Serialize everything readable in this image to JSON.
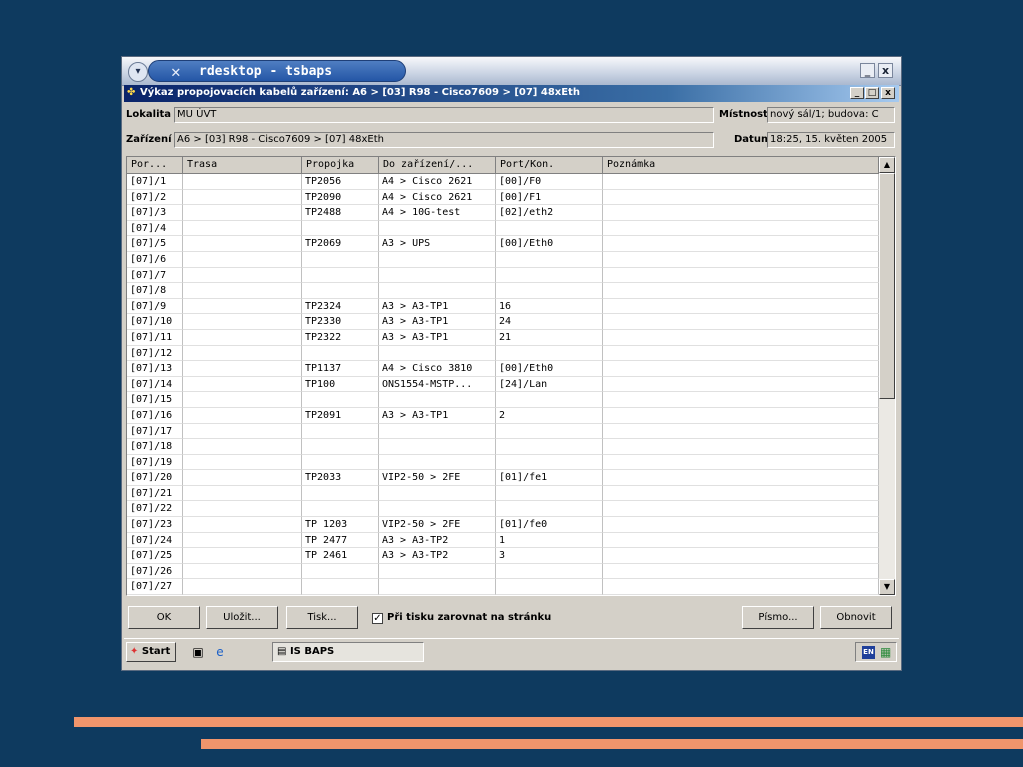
{
  "rdesktop": {
    "title": "rdesktop - tsbaps",
    "buttons": {
      "minimize": "_",
      "close": "x"
    }
  },
  "app": {
    "title": "Výkaz propojovacích kabelů zařízení: A6 > [03] R98 - Cisco7609 > [07] 48xEth",
    "buttons": {
      "minimize": "_",
      "maximize": "□",
      "close": "x"
    }
  },
  "fields": {
    "lokalita": {
      "label": "Lokalita",
      "value": "MU ÚVT"
    },
    "zarizeni": {
      "label": "Zařízení",
      "value": "A6 > [03] R98 - Cisco7609 > [07] 48xEth"
    },
    "mistnost": {
      "label": "Místnost",
      "value": "nový sál/1; budova: C"
    },
    "datum": {
      "label": "Datum",
      "value": "18:25, 15. květen 2005"
    }
  },
  "table": {
    "headers": [
      "Por...",
      "Trasa",
      "Propojka",
      "Do zařízení/...",
      "Port/Kon.",
      "Poznámka"
    ],
    "rows": [
      [
        "[07]/1",
        "",
        "TP2056",
        "A4 > Cisco 2621",
        "[00]/F0",
        ""
      ],
      [
        "[07]/2",
        "",
        "TP2090",
        "A4 > Cisco 2621",
        "[00]/F1",
        ""
      ],
      [
        "[07]/3",
        "",
        "TP2488",
        "A4 > 10G-test",
        "[02]/eth2",
        ""
      ],
      [
        "[07]/4",
        "",
        "",
        "",
        "",
        ""
      ],
      [
        "[07]/5",
        "",
        "TP2069",
        "A3 > UPS",
        "[00]/Eth0",
        ""
      ],
      [
        "[07]/6",
        "",
        "",
        "",
        "",
        ""
      ],
      [
        "[07]/7",
        "",
        "",
        "",
        "",
        ""
      ],
      [
        "[07]/8",
        "",
        "",
        "",
        "",
        ""
      ],
      [
        "[07]/9",
        "",
        "TP2324",
        "A3 > A3-TP1",
        "16",
        ""
      ],
      [
        "[07]/10",
        "",
        "TP2330",
        "A3 > A3-TP1",
        "24",
        ""
      ],
      [
        "[07]/11",
        "",
        "TP2322",
        "A3 > A3-TP1",
        "21",
        ""
      ],
      [
        "[07]/12",
        "",
        "",
        "",
        "",
        ""
      ],
      [
        "[07]/13",
        "",
        "TP1137",
        "A4 > Cisco 3810",
        "[00]/Eth0",
        ""
      ],
      [
        "[07]/14",
        "",
        "TP100",
        "ONS1554-MSTP...",
        "[24]/Lan",
        ""
      ],
      [
        "[07]/15",
        "",
        "",
        "",
        "",
        ""
      ],
      [
        "[07]/16",
        "",
        "TP2091",
        "A3 > A3-TP1",
        "2",
        ""
      ],
      [
        "[07]/17",
        "",
        "",
        "",
        "",
        ""
      ],
      [
        "[07]/18",
        "",
        "",
        "",
        "",
        ""
      ],
      [
        "[07]/19",
        "",
        "",
        "",
        "",
        ""
      ],
      [
        "[07]/20",
        "",
        "TP2033",
        "VIP2-50 > 2FE",
        "[01]/fe1",
        ""
      ],
      [
        "[07]/21",
        "",
        "",
        "",
        "",
        ""
      ],
      [
        "[07]/22",
        "",
        "",
        "",
        "",
        ""
      ],
      [
        "[07]/23",
        "",
        "TP 1203",
        "VIP2-50 > 2FE",
        "[01]/fe0",
        ""
      ],
      [
        "[07]/24",
        "",
        "TP 2477",
        "A3 > A3-TP2",
        "1",
        ""
      ],
      [
        "[07]/25",
        "",
        "TP 2461",
        "A3 > A3-TP2",
        "3",
        ""
      ],
      [
        "[07]/26",
        "",
        "",
        "",
        "",
        ""
      ],
      [
        "[07]/27",
        "",
        "",
        "",
        "",
        ""
      ]
    ]
  },
  "footer": {
    "ok": "OK",
    "ulozit": "Uložit...",
    "tisk": "Tisk...",
    "checkbox_label": "Při tisku zarovnat na stránku",
    "checkbox_checked": true,
    "checkmark": "✓",
    "pismo": "Písmo...",
    "obnovit": "Obnovit"
  },
  "taskbar": {
    "start": "Start",
    "task": "IS BAPS",
    "lang": "EN"
  },
  "colors": {
    "background": "#0e3a5f",
    "accent_bars": "#f0956c",
    "titlebar": "#0a246a"
  }
}
